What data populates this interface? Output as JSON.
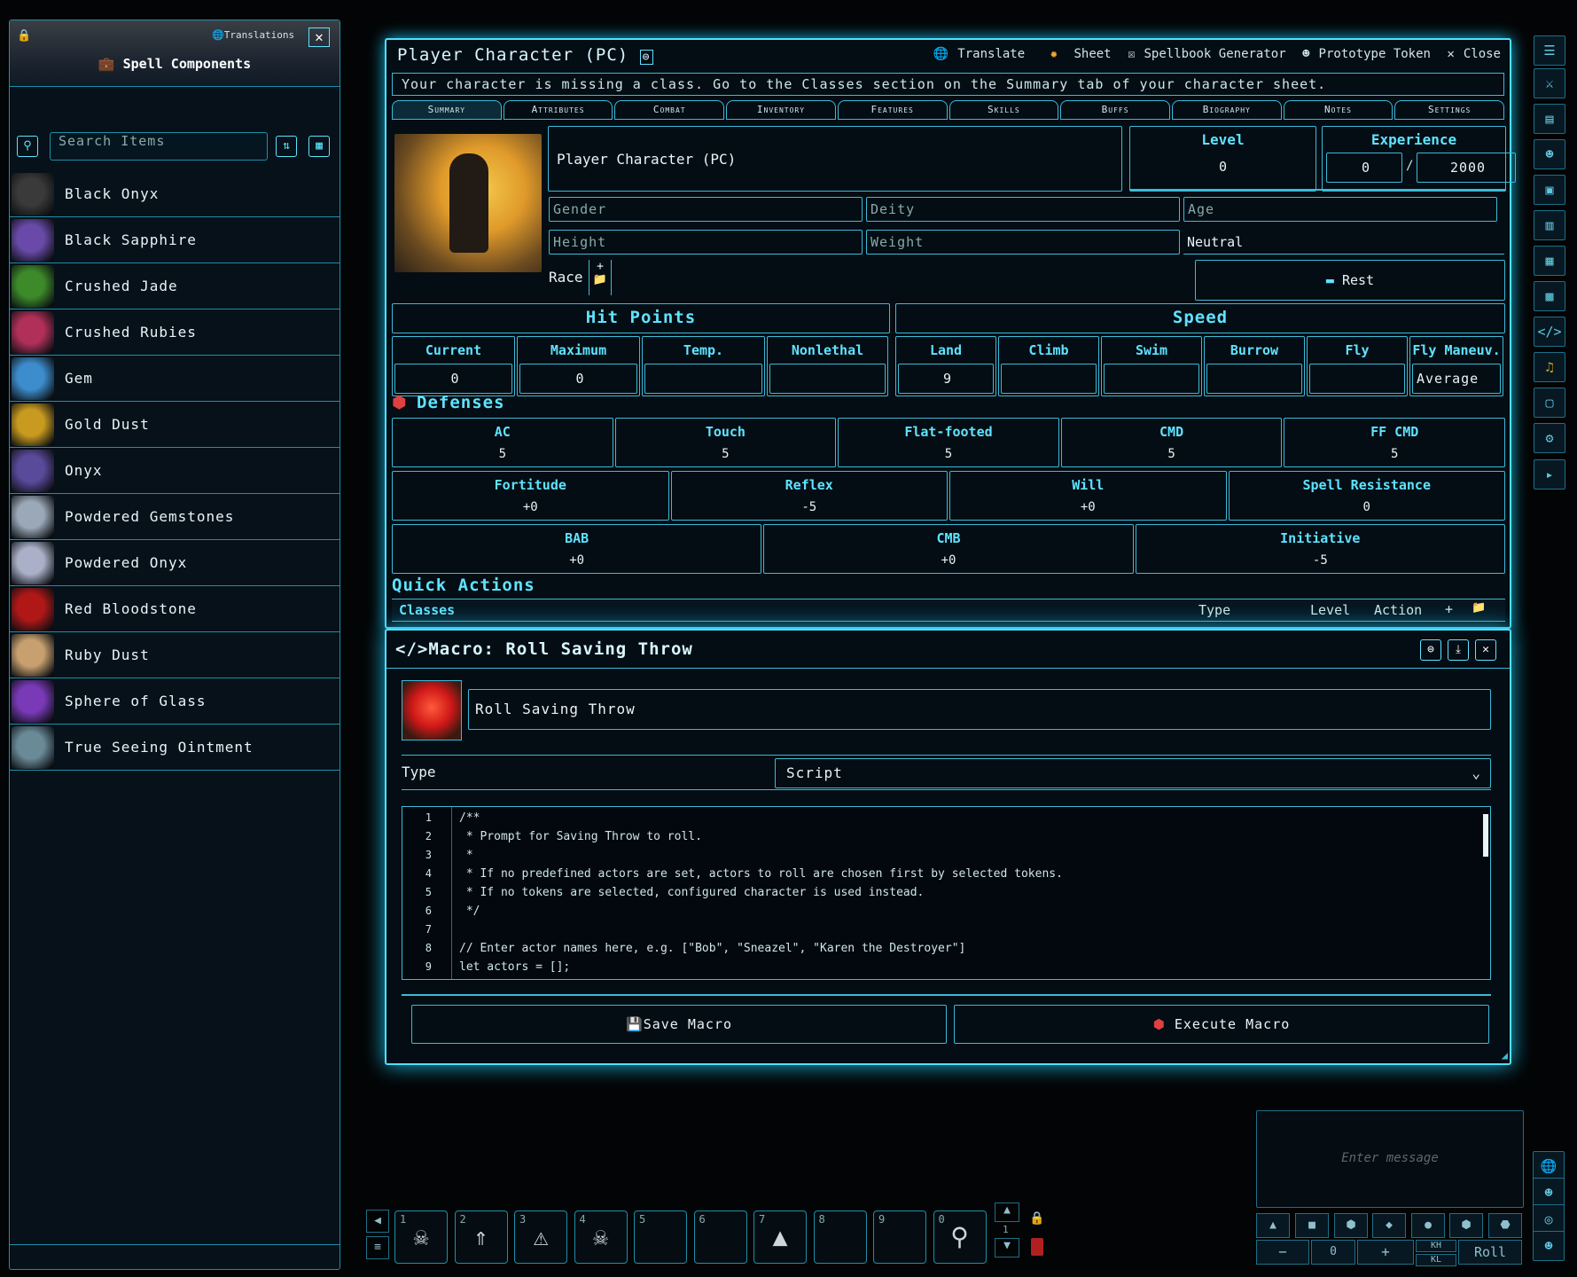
{
  "left_panel": {
    "title": "Spell Components",
    "translations_label": "Translations",
    "search_placeholder": "Search Items",
    "items": [
      {
        "name": "Black Onyx",
        "color": "#3a3a3a"
      },
      {
        "name": "Black Sapphire",
        "color": "#6a4aa8"
      },
      {
        "name": "Crushed Jade",
        "color": "#3d8a2a"
      },
      {
        "name": "Crushed Rubies",
        "color": "#b0305a"
      },
      {
        "name": "Gem",
        "color": "#3d8ccc"
      },
      {
        "name": "Gold Dust",
        "color": "#c89a20"
      },
      {
        "name": "Onyx",
        "color": "#5a4a9a"
      },
      {
        "name": "Powdered Gemstones",
        "color": "#9aa8b8"
      },
      {
        "name": "Powdered Onyx",
        "color": "#aab0c8"
      },
      {
        "name": "Red Bloodstone",
        "color": "#b01818"
      },
      {
        "name": "Ruby Dust",
        "color": "#c8a070"
      },
      {
        "name": "Sphere of Glass",
        "color": "#7a3ab8"
      },
      {
        "name": "True Seeing Ointment",
        "color": "#6a8a98"
      }
    ]
  },
  "sheet": {
    "title": "Player Character (PC)",
    "tools": {
      "translate": "Translate",
      "sheet": "Sheet",
      "spellbook": "Spellbook Generator",
      "token": "Prototype Token",
      "close": "Close"
    },
    "warning": "Your character is missing a class. Go to the Classes section on the Summary tab of your character sheet.",
    "tabs": [
      "Summary",
      "Attributes",
      "Combat",
      "Inventory",
      "Features",
      "Skills",
      "Buffs",
      "Biography",
      "Notes",
      "Settings"
    ],
    "name": "Player Character (PC)",
    "level_label": "Level",
    "level": "0",
    "experience_label": "Experience",
    "xp_current": "0",
    "xp_sep": "/",
    "xp_max": "2000",
    "gender_ph": "Gender",
    "deity_ph": "Deity",
    "age_ph": "Age",
    "height_ph": "Height",
    "weight_ph": "Weight",
    "alignment": "Neutral",
    "race_label": "Race",
    "rest_label": "Rest",
    "hp_title": "Hit Points",
    "hp_cols": [
      "Current",
      "Maximum",
      "Temp.",
      "Nonlethal"
    ],
    "hp_vals": [
      "0",
      "0",
      "",
      ""
    ],
    "speed_title": "Speed",
    "speed_cols": [
      "Land",
      "Climb",
      "Swim",
      "Burrow",
      "Fly",
      "Fly Maneuv."
    ],
    "speed_vals": [
      "9",
      "",
      "",
      "",
      ""
    ],
    "fly_maneuver": "Average",
    "defenses_title": "Defenses",
    "def_row": [
      {
        "l": "AC",
        "v": "5"
      },
      {
        "l": "Touch",
        "v": "5"
      },
      {
        "l": "Flat-footed",
        "v": "5"
      },
      {
        "l": "CMD",
        "v": "5"
      },
      {
        "l": "FF CMD",
        "v": "5"
      }
    ],
    "saves_row": [
      {
        "l": "Fortitude",
        "v": "+0"
      },
      {
        "l": "Reflex",
        "v": "-5"
      },
      {
        "l": "Will",
        "v": "+0"
      },
      {
        "l": "Spell Resistance",
        "v": "0"
      }
    ],
    "bab_row": [
      {
        "l": "BAB",
        "v": "+0"
      },
      {
        "l": "CMB",
        "v": "+0"
      },
      {
        "l": "Initiative",
        "v": "-5"
      }
    ],
    "quick_actions": "Quick Actions",
    "classes_table": {
      "name": "Classes",
      "type": "Type",
      "level": "Level",
      "action": "Action"
    }
  },
  "macro": {
    "title": "Macro: Roll Saving Throw",
    "name": "Roll Saving Throw",
    "type_label": "Type",
    "type_value": "Script",
    "code_lines": [
      "/**",
      " * Prompt for Saving Throw to roll.",
      " *",
      " * If no predefined actors are set, actors to roll are chosen first by selected tokens.",
      " * If no tokens are selected, configured character is used instead.",
      " */",
      "",
      "// Enter actor names here, e.g. [\"Bob\", \"Sneazel\", \"Karen the Destroyer\"]",
      "let actors = [];"
    ],
    "line_numbers": [
      "1",
      "2",
      "3",
      "4",
      "5",
      "6",
      "7",
      "8",
      "9"
    ],
    "save_label": "Save Macro",
    "execute_label": "Execute Macro"
  },
  "hotbar": {
    "slots": [
      "1",
      "2",
      "3",
      "4",
      "5",
      "6",
      "7",
      "8",
      "9",
      "0"
    ],
    "page": "1"
  },
  "chat": {
    "placeholder": "Enter message",
    "modifier": "0",
    "minus": "−",
    "plus": "+",
    "kh": "KH",
    "kl": "KL",
    "roll_label": "Roll"
  }
}
